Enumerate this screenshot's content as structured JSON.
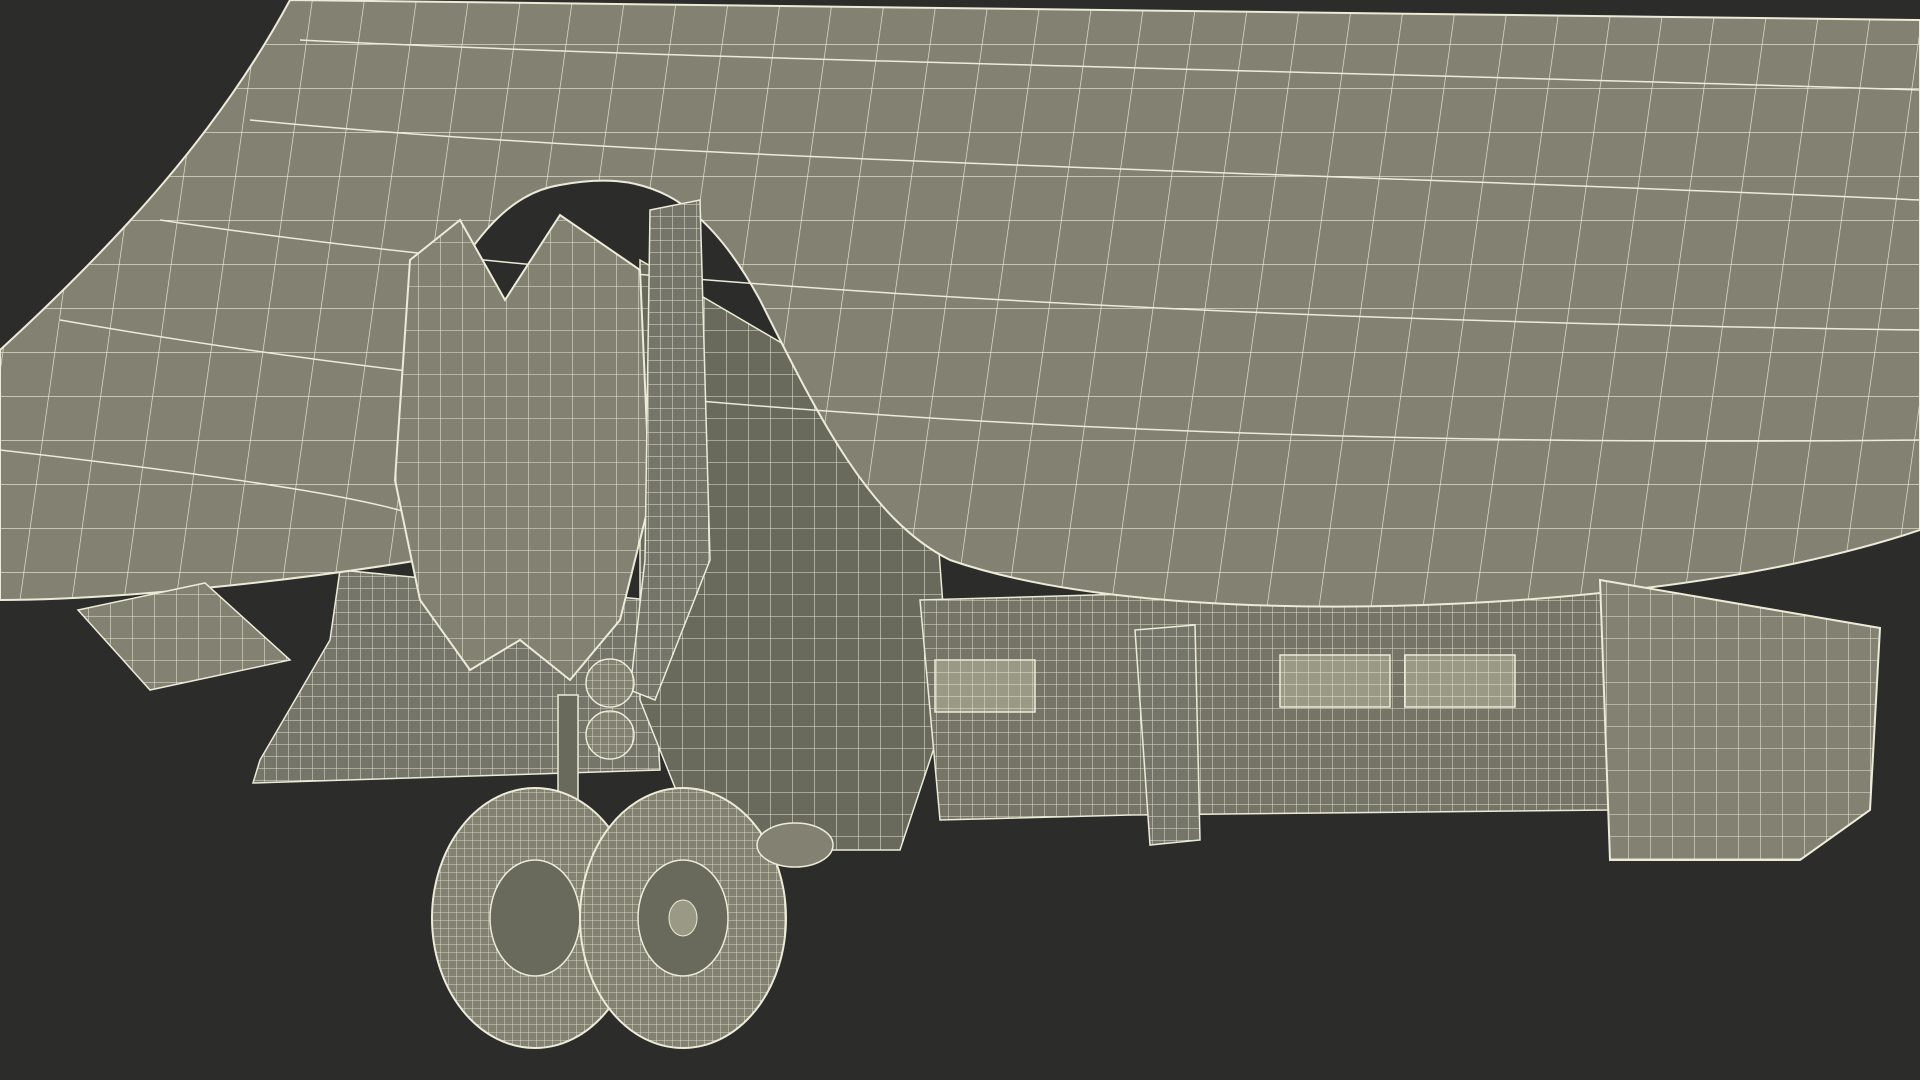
{
  "scene": {
    "subject": "aircraft-wireframe-render",
    "colors": {
      "background": "#2c2c2a",
      "surface": "#838272",
      "surface_dark": "#6a6a5c",
      "wire": "#ecebd8",
      "detail": "#9a9986"
    }
  }
}
